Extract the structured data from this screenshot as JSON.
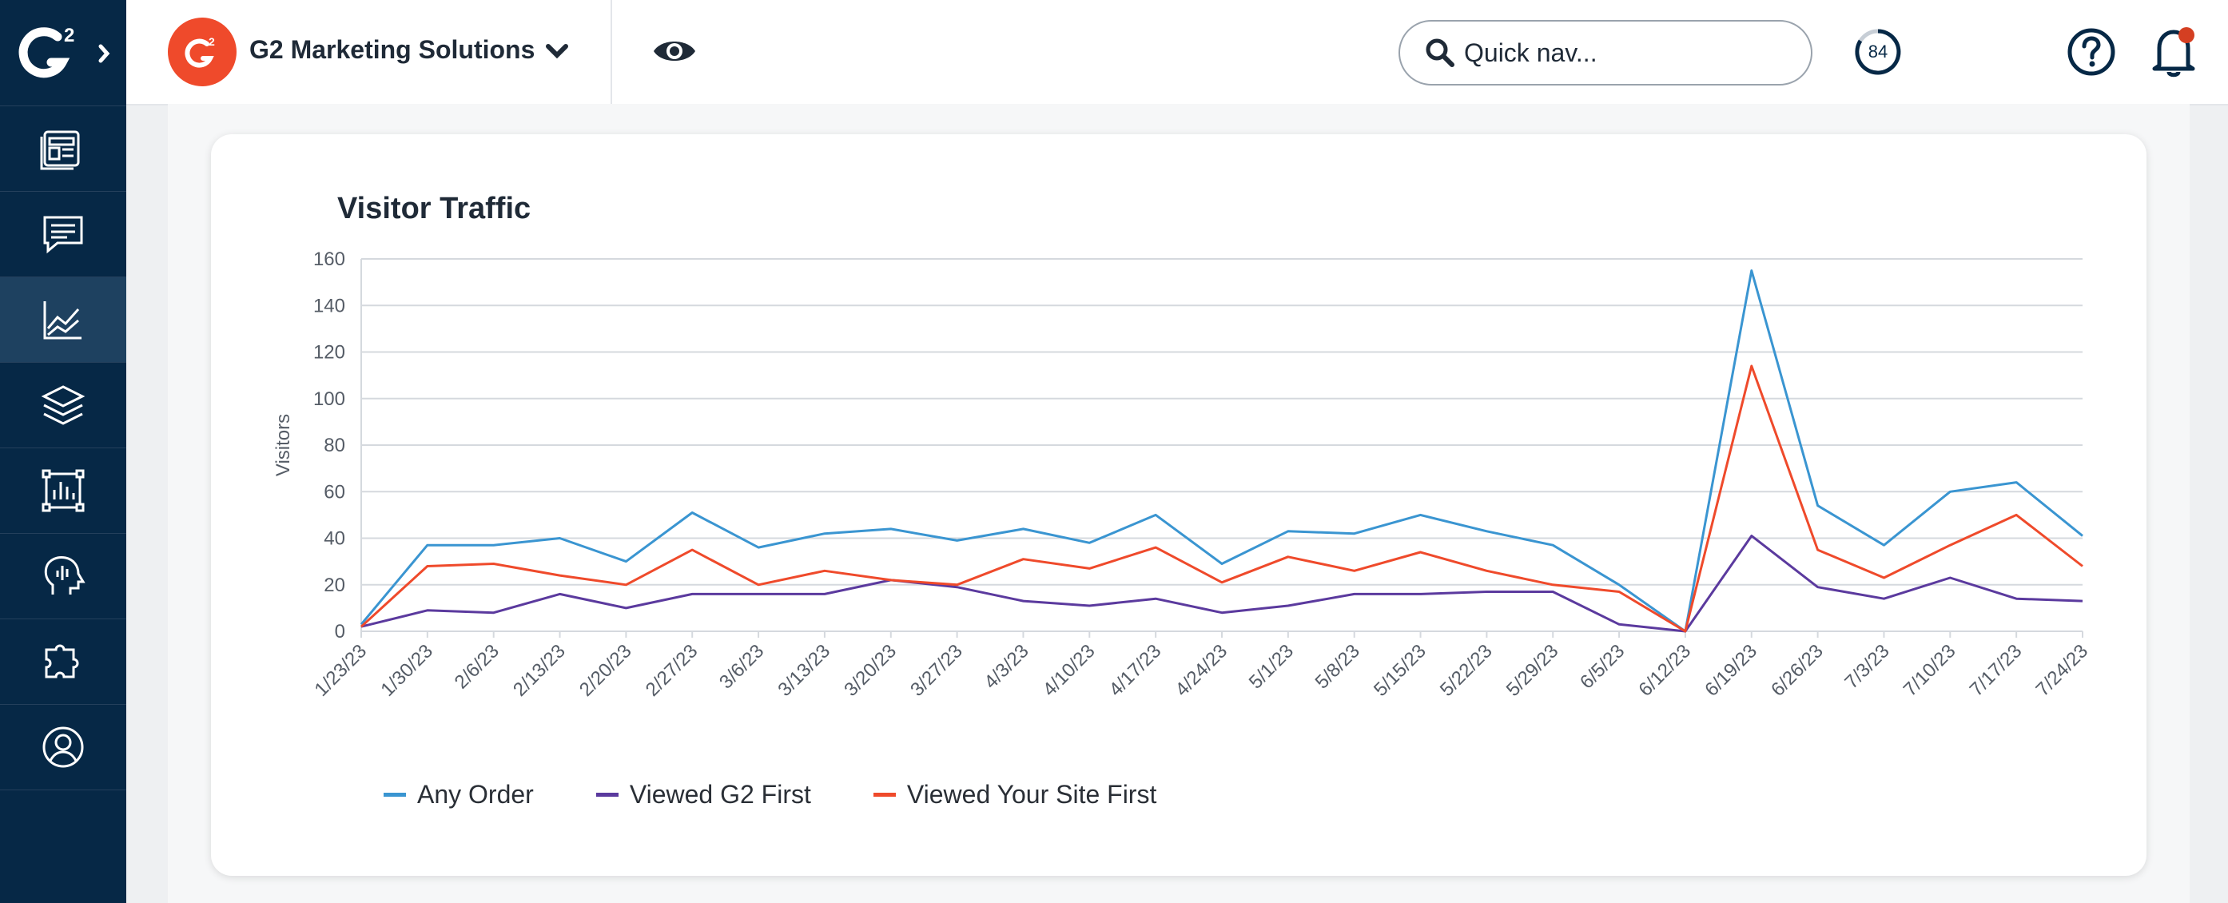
{
  "header": {
    "brand_name": "G2 Marketing Solutions",
    "search_placeholder": "Quick nav...",
    "score": "84",
    "brand_color": "#ef4a2b"
  },
  "sidebar": {
    "items": [
      {
        "icon": "dashboard-icon",
        "active": false
      },
      {
        "icon": "chat-icon",
        "active": false
      },
      {
        "icon": "analytics-icon",
        "active": true
      },
      {
        "icon": "layers-icon",
        "active": false
      },
      {
        "icon": "report-icon",
        "active": false
      },
      {
        "icon": "head-insights-icon",
        "active": false
      },
      {
        "icon": "puzzle-icon",
        "active": false
      },
      {
        "icon": "user-circle-icon",
        "active": false
      }
    ]
  },
  "chart_data": {
    "type": "line",
    "title": "Visitor Traffic",
    "xlabel": "",
    "ylabel": "Visitors",
    "ylim": [
      0,
      160
    ],
    "yticks": [
      0,
      20,
      40,
      60,
      80,
      100,
      120,
      140,
      160
    ],
    "grid": true,
    "legend_position": "bottom-left",
    "categories": [
      "1/23/23",
      "1/30/23",
      "2/6/23",
      "2/13/23",
      "2/20/23",
      "2/27/23",
      "3/6/23",
      "3/13/23",
      "3/20/23",
      "3/27/23",
      "4/3/23",
      "4/10/23",
      "4/17/23",
      "4/24/23",
      "5/1/23",
      "5/8/23",
      "5/15/23",
      "5/22/23",
      "5/29/23",
      "6/5/23",
      "6/12/23",
      "6/19/23",
      "6/26/23",
      "7/3/23",
      "7/10/23",
      "7/17/23",
      "7/24/23"
    ],
    "series": [
      {
        "name": "Any Order",
        "color": "#3a95d1",
        "values": [
          3,
          37,
          37,
          40,
          30,
          51,
          36,
          42,
          44,
          39,
          44,
          38,
          50,
          29,
          43,
          42,
          50,
          43,
          37,
          20,
          0,
          155,
          54,
          37,
          60,
          64,
          41
        ]
      },
      {
        "name": "Viewed G2 First",
        "color": "#5b3a9e",
        "values": [
          2,
          9,
          8,
          16,
          10,
          16,
          16,
          16,
          22,
          19,
          13,
          11,
          14,
          8,
          11,
          16,
          16,
          17,
          17,
          3,
          0,
          41,
          19,
          14,
          23,
          14,
          13
        ]
      },
      {
        "name": "Viewed Your Site First",
        "color": "#ef4a2b",
        "values": [
          2,
          28,
          29,
          24,
          20,
          35,
          20,
          26,
          22,
          20,
          31,
          27,
          36,
          21,
          32,
          26,
          34,
          26,
          20,
          17,
          0,
          114,
          35,
          23,
          37,
          50,
          28
        ]
      }
    ]
  }
}
